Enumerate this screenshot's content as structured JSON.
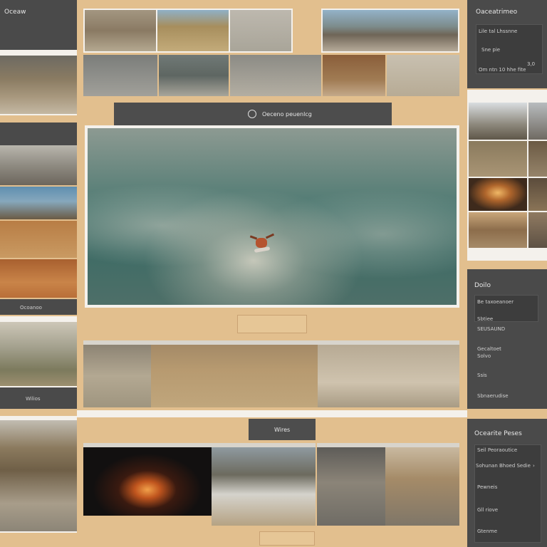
{
  "left_panel": {
    "header": "Oceaw",
    "footer": "Ocoanoo",
    "bottom_label": "Wilios"
  },
  "center_bar": {
    "label": "Oeceno peuenlcg"
  },
  "bottom_tab": {
    "label": "Wires"
  },
  "right_top_panel": {
    "title": "Oaceatrimeo",
    "rows": [
      "Lile tal Lhssnne",
      "Sne pie",
      "Om ntn 10 hhe fite"
    ],
    "value": "3,0"
  },
  "right_mid_panel": {
    "title": "Doilo",
    "rows": [
      "Be taxoeanoer",
      "Sbtiee",
      "SEUSAUND",
      "Gecaltoet",
      "Solvo",
      "Ssis",
      "Sbnaerudise"
    ]
  },
  "right_bottom_panel": {
    "title": "Ocearite Peses",
    "rows": [
      "Seil Peoraoutice",
      "Sohunan Bhoed Sedie",
      "Pewneis",
      "Gll riove",
      "Gtenme"
    ]
  },
  "colors": {
    "background": "#e2bf8e",
    "panel": "#4a4a4a",
    "sea": "#4f7a73"
  }
}
